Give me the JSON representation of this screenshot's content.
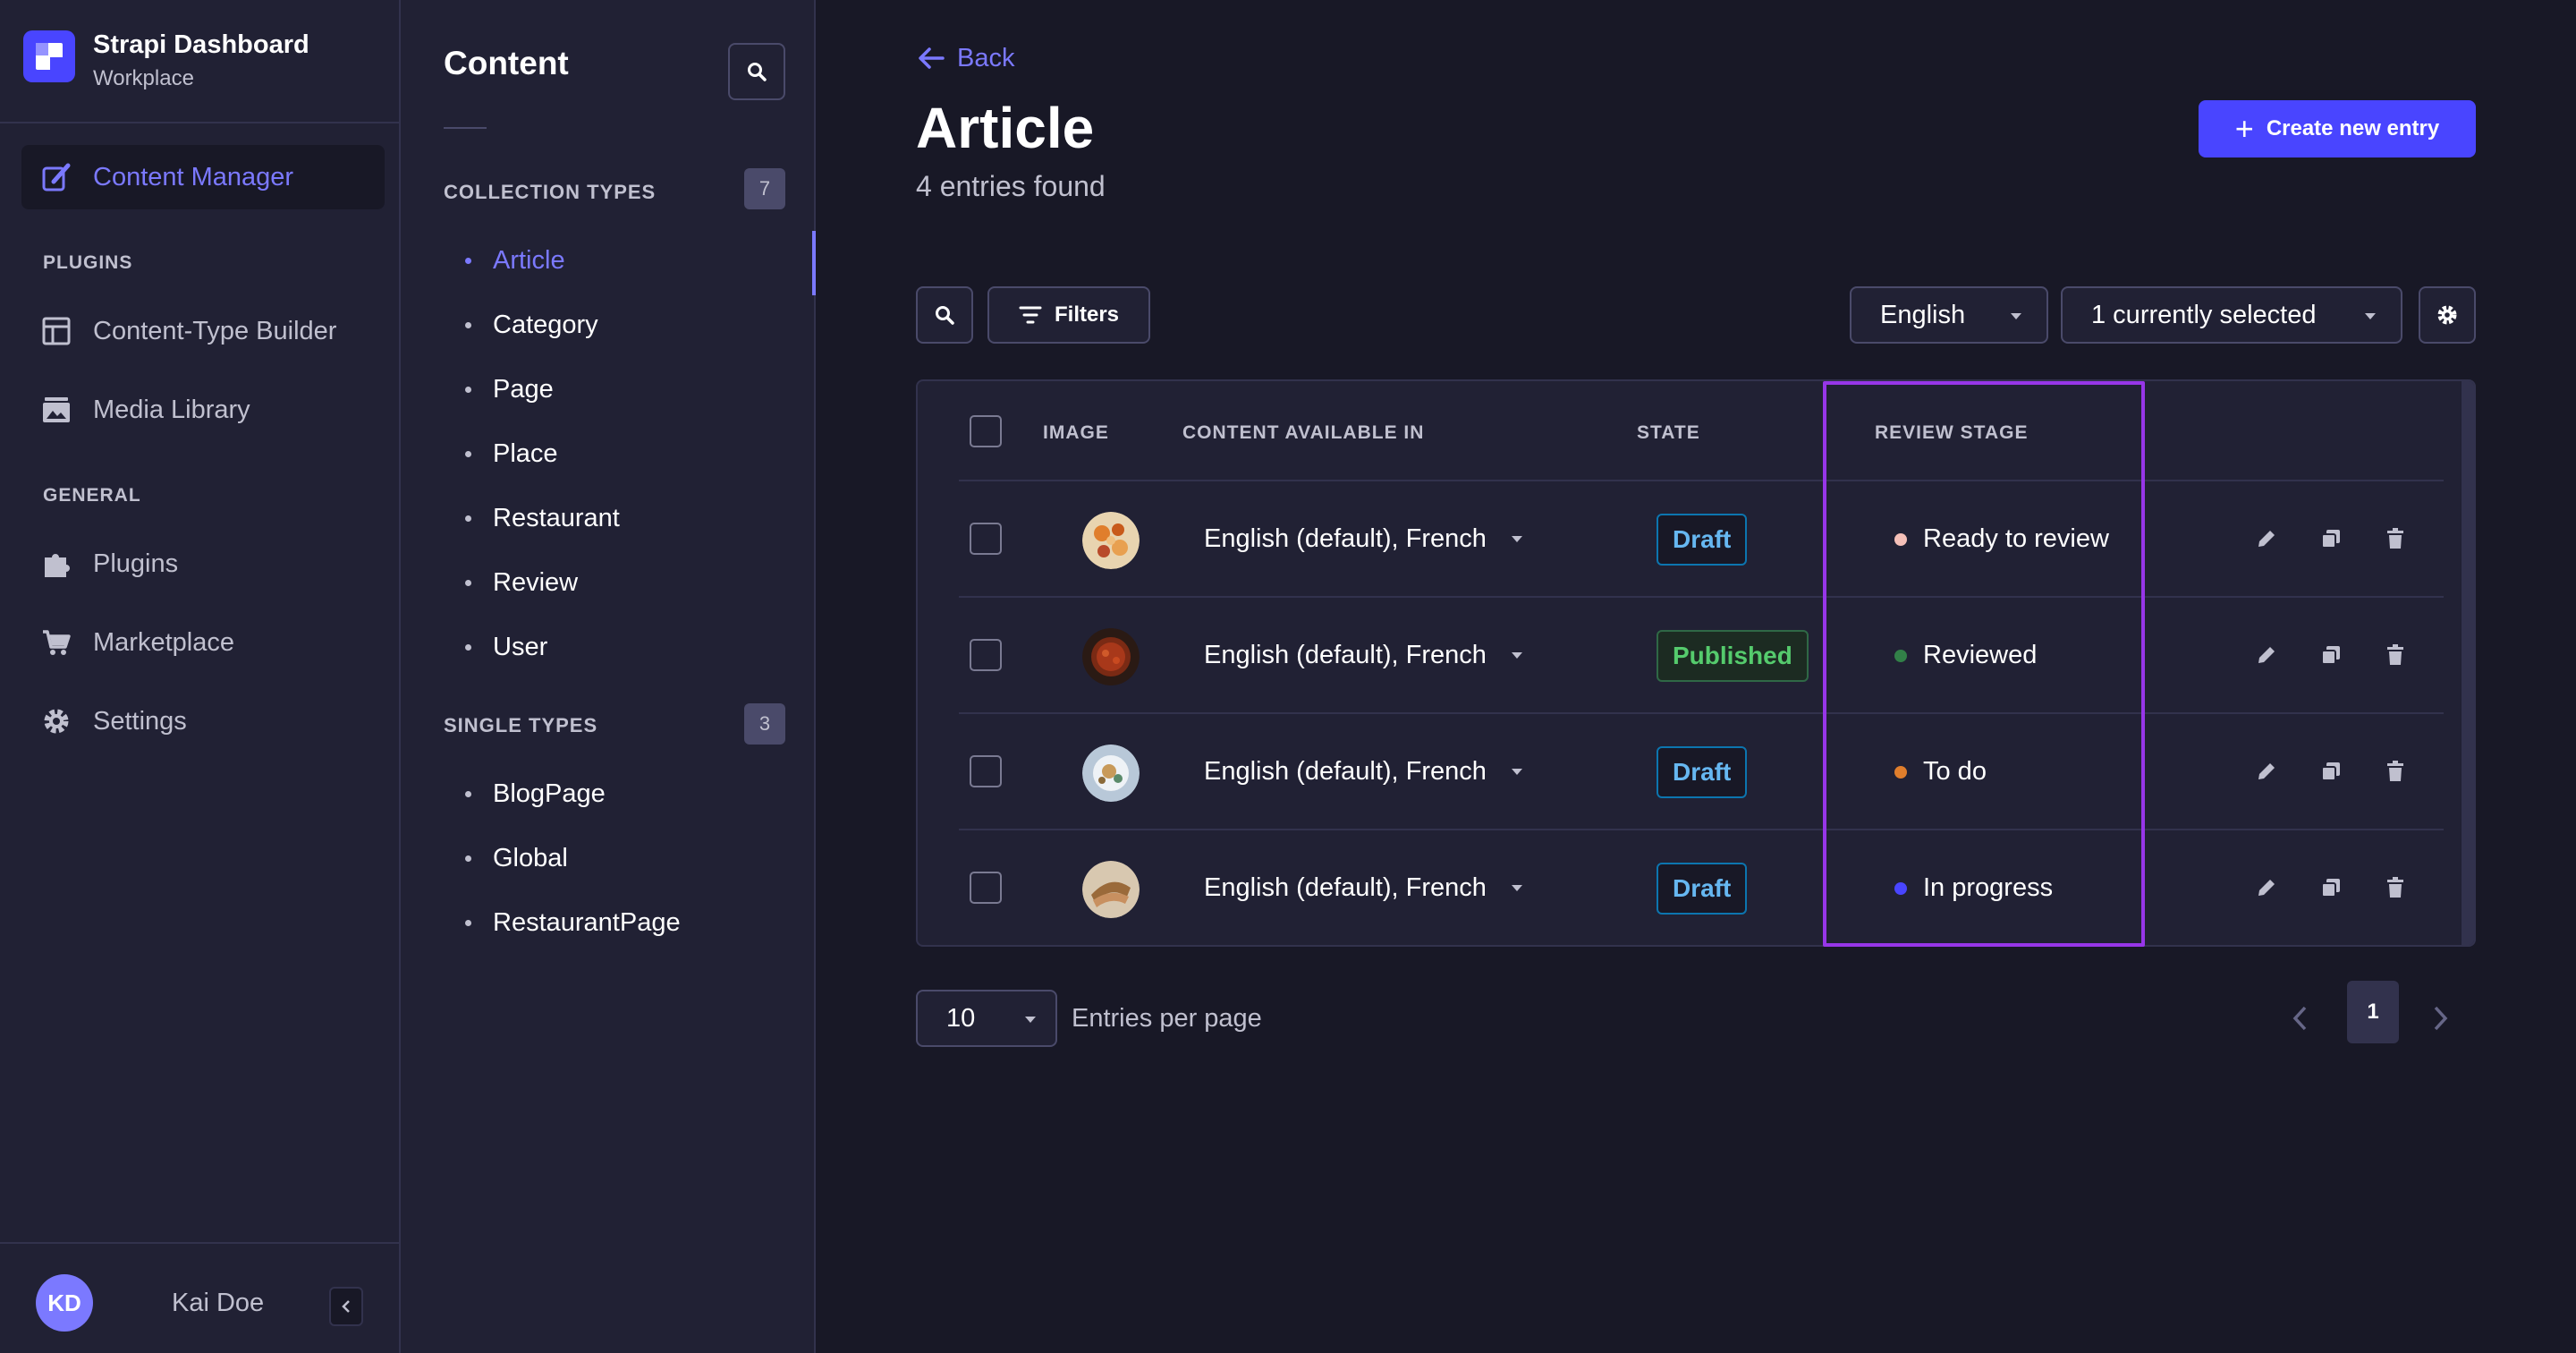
{
  "brand": {
    "title": "Strapi Dashboard",
    "subtitle": "Workplace"
  },
  "mainnav": {
    "content_manager": "Content Manager",
    "plugins_section": "PLUGINS",
    "content_type_builder": "Content-Type Builder",
    "media_library": "Media Library",
    "general_section": "GENERAL",
    "plugins": "Plugins",
    "marketplace": "Marketplace",
    "settings": "Settings"
  },
  "user": {
    "initials": "KD",
    "name": "Kai Doe"
  },
  "subnav": {
    "title": "Content",
    "collection_label": "COLLECTION TYPES",
    "collection_count": "7",
    "collection_items": [
      "Article",
      "Category",
      "Page",
      "Place",
      "Restaurant",
      "Review",
      "User"
    ],
    "single_label": "SINGLE TYPES",
    "single_count": "3",
    "single_items": [
      "BlogPage",
      "Global",
      "RestaurantPage"
    ]
  },
  "header": {
    "back": "Back",
    "title": "Article",
    "subtitle": "4 entries found",
    "create": "Create new entry"
  },
  "toolbar": {
    "filters": "Filters",
    "locale": "English",
    "columns": "1 currently selected"
  },
  "table": {
    "headers": {
      "image": "IMAGE",
      "locales": "CONTENT AVAILABLE IN",
      "state": "STATE",
      "stage": "REVIEW STAGE"
    },
    "rows": [
      {
        "locales": "English (default), French",
        "state": "Draft",
        "stage": "Ready to review",
        "stage_color": "#f5c0b8"
      },
      {
        "locales": "English (default), French",
        "state": "Published",
        "stage": "Reviewed",
        "stage_color": "#328048"
      },
      {
        "locales": "English (default), French",
        "state": "Draft",
        "stage": "To do",
        "stage_color": "#e07e2c"
      },
      {
        "locales": "English (default), French",
        "state": "Draft",
        "stage": "In progress",
        "stage_color": "#4945ff"
      }
    ]
  },
  "pagination": {
    "per_page": "10",
    "per_page_label": "Entries per page",
    "current_page": "1"
  },
  "colors": {
    "accent": "#4945ff",
    "accent_text": "#7b79ff",
    "highlight": "#9736e8"
  }
}
